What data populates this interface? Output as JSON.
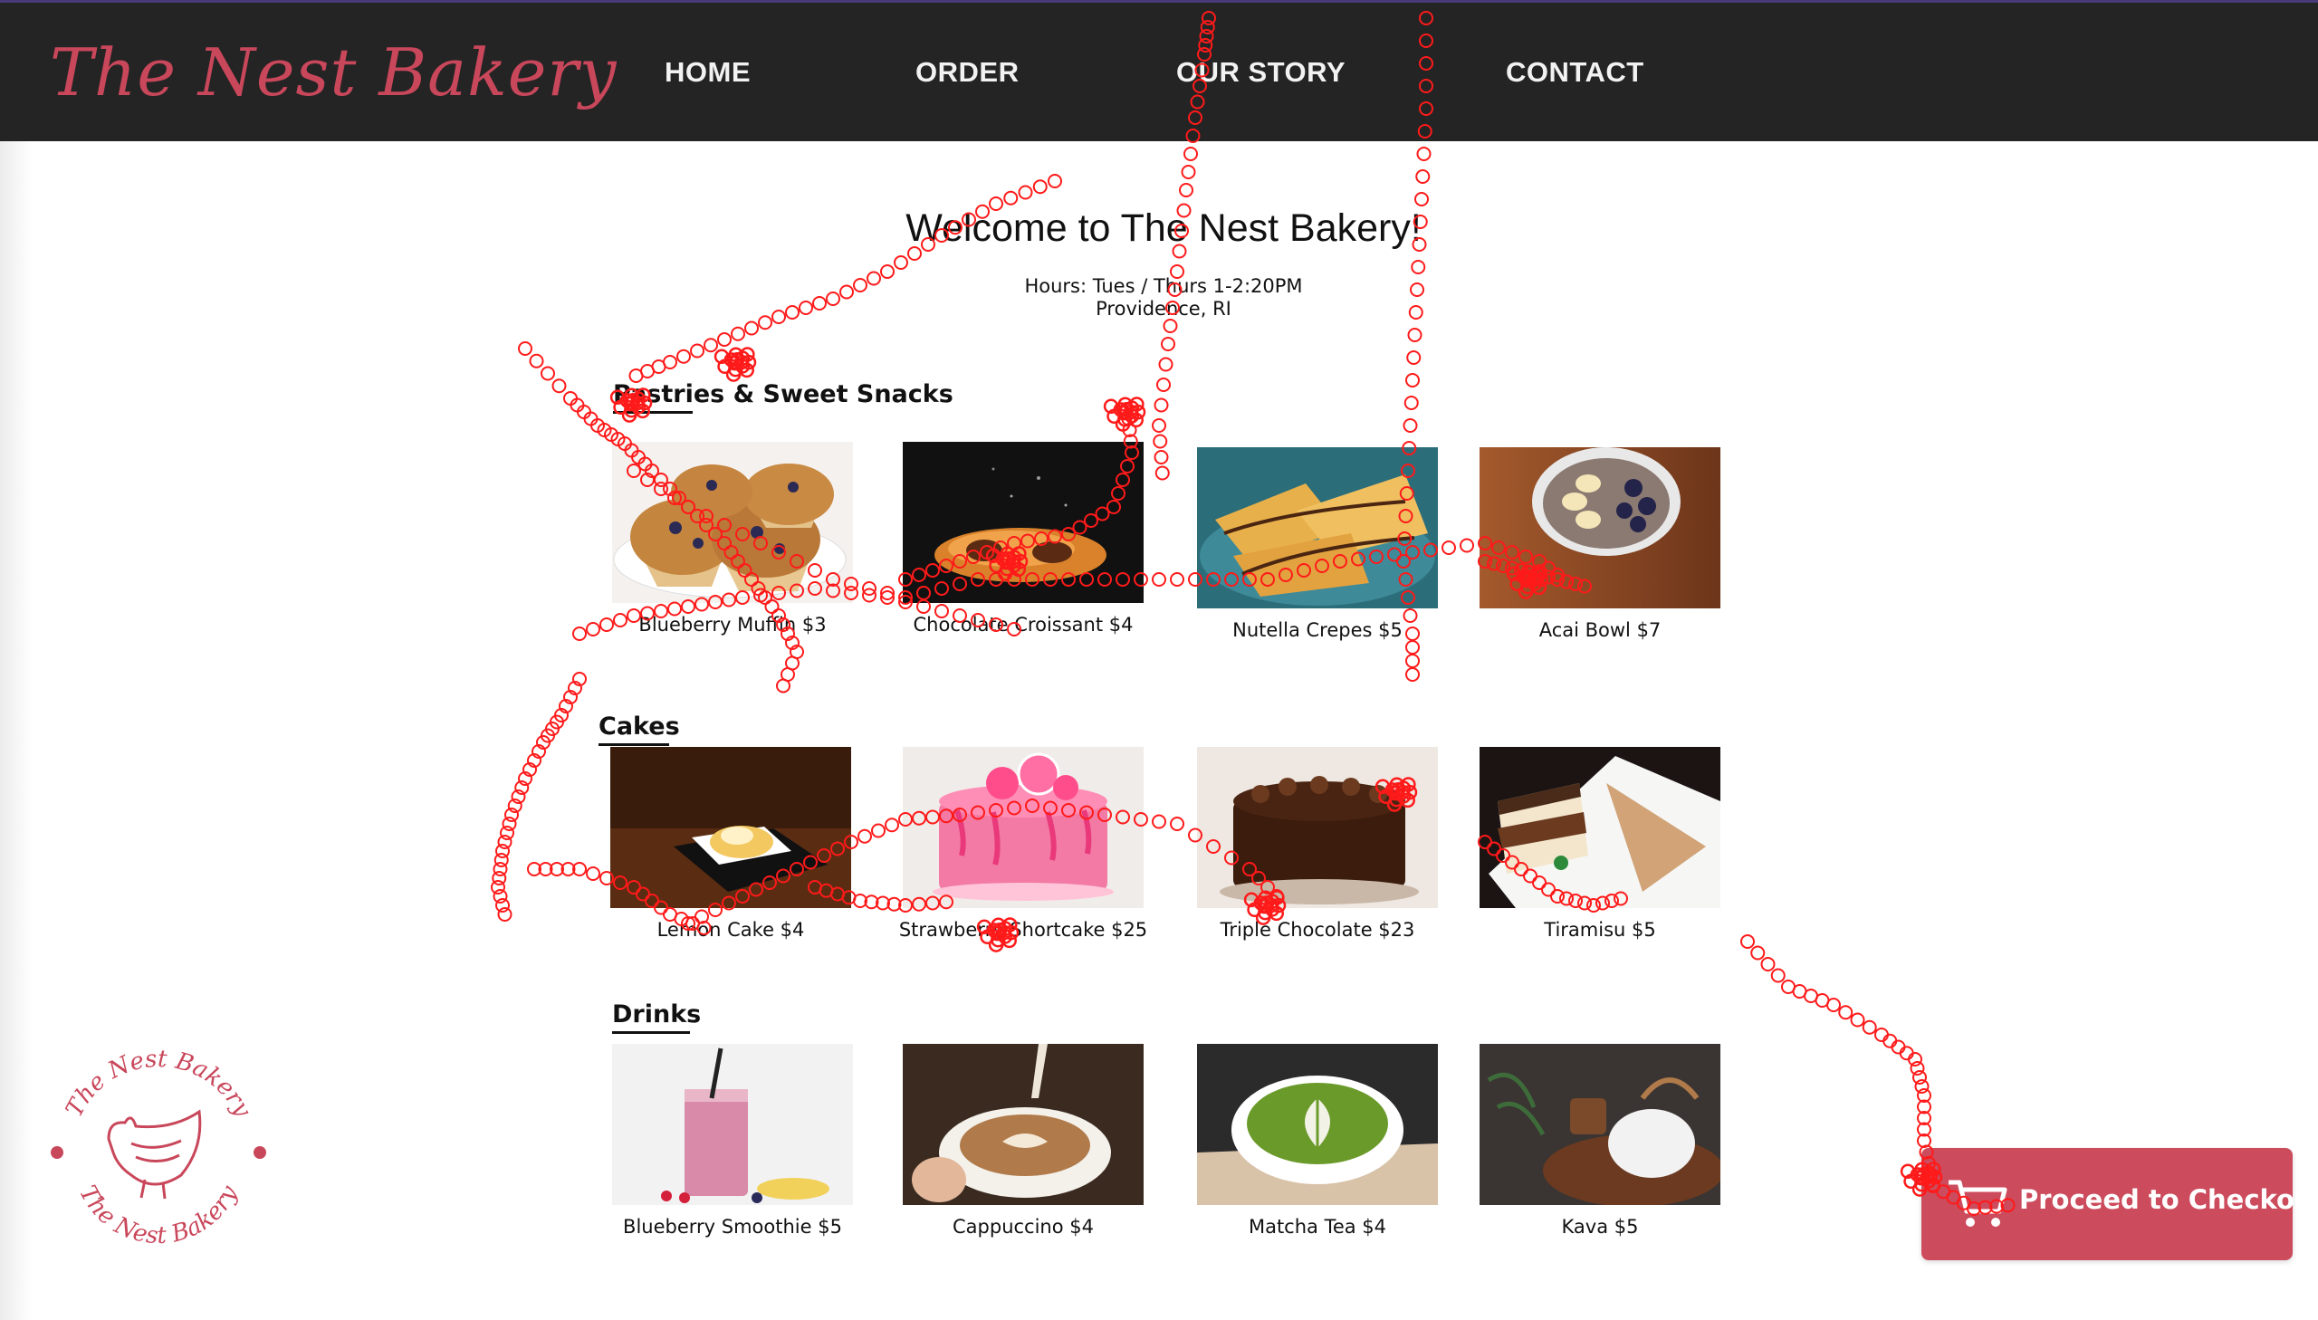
{
  "header": {
    "brand": "The Nest Bakery",
    "nav": [
      {
        "label": "HOME"
      },
      {
        "label": "ORDER"
      },
      {
        "label": "OUR STORY"
      },
      {
        "label": "CONTACT"
      }
    ]
  },
  "main": {
    "welcome": "Welcome to The Nest Bakery!",
    "hours": "Hours: Tues / Thurs 1-2:20PM",
    "location": "Providence, RI"
  },
  "sections": [
    {
      "title": "Pastries & Sweet Snacks",
      "items": [
        {
          "label": "Blueberry Muffin $3"
        },
        {
          "label": "Chocolate Croissant $4"
        },
        {
          "label": "Nutella Crepes $5"
        },
        {
          "label": "Acai Bowl $7"
        }
      ]
    },
    {
      "title": "Cakes",
      "items": [
        {
          "label": "Lemon Cake $4"
        },
        {
          "label": "Strawberry Shortcake $25"
        },
        {
          "label": "Triple Chocolate $23"
        },
        {
          "label": "Tiramisu $5"
        }
      ]
    },
    {
      "title": "Drinks",
      "items": [
        {
          "label": "Blueberry Smoothie $5"
        },
        {
          "label": "Cappuccino $4"
        },
        {
          "label": "Matcha Tea $4"
        },
        {
          "label": "Kava $5"
        }
      ]
    }
  ],
  "checkout": {
    "label": "Proceed to Checkout"
  },
  "stamp": {
    "text_top": "The Nest Bakery",
    "text_bottom": "The Nest Bakery"
  },
  "colors": {
    "brand": "#c9475b",
    "nav_bg": "#242424",
    "checkout_bg": "#cc4b5c",
    "gaze_marker": "#ff1a1a"
  },
  "icons": {
    "cart": "shopping-cart-icon",
    "stamp": "hen-logo"
  }
}
